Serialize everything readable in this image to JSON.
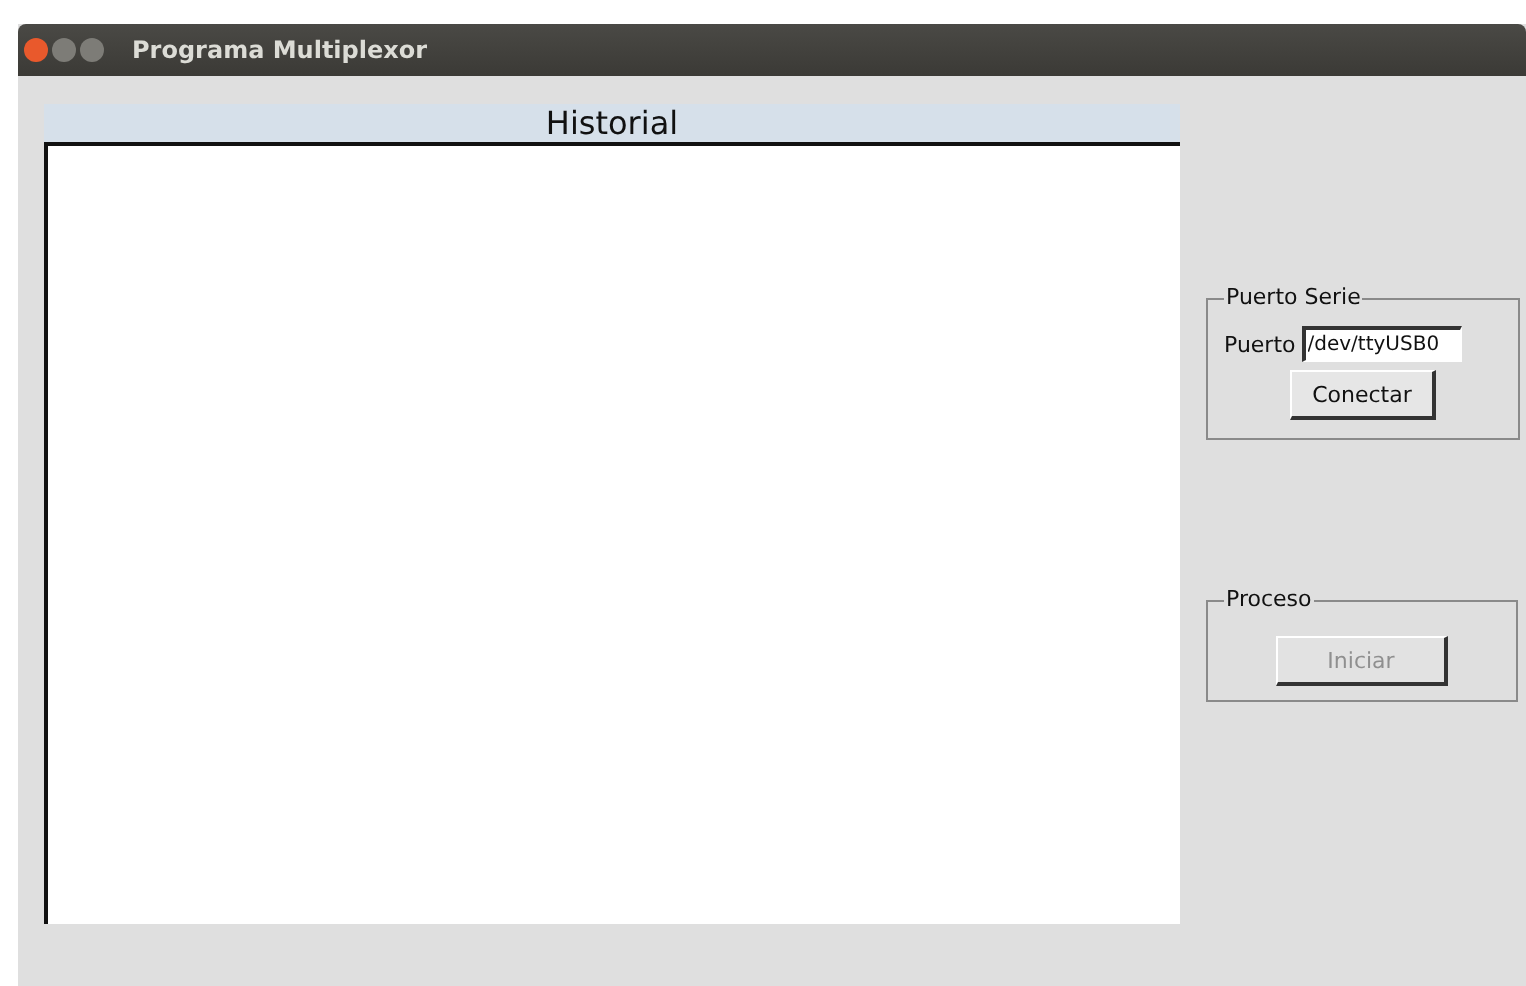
{
  "window": {
    "title": "Programa Multiplexor"
  },
  "history": {
    "title": "Historial"
  },
  "serial_port": {
    "legend": "Puerto Serie",
    "label": "Puerto",
    "value": "/dev/ttyUSB0",
    "button": {
      "label": "Conectar",
      "disabled": false
    }
  },
  "process": {
    "legend": "Proceso",
    "button": {
      "label": "Iniciar",
      "disabled": true
    }
  }
}
